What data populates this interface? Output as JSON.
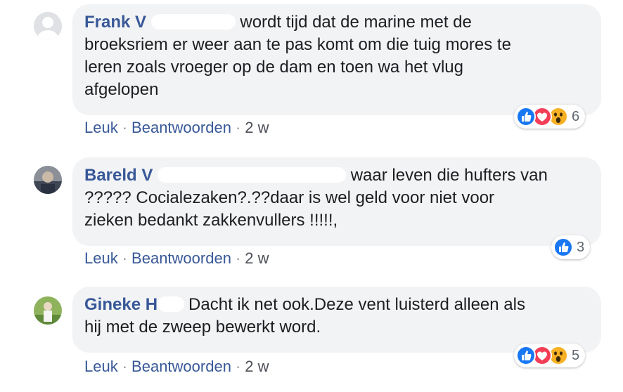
{
  "comments": [
    {
      "name": "Frank V",
      "line1": "wordt tijd dat de marine met de",
      "line2": "broeksriem er weer aan te pas komt om die tuig mores te",
      "line3": "leren zoals vroeger op de dam en toen wa het vlug",
      "line4": "afgelopen",
      "actions": {
        "like": "Leuk",
        "reply": "Beantwoorden",
        "time": "2 w"
      },
      "reactions": {
        "icons": [
          "like-icon",
          "love-icon",
          "wow-icon"
        ],
        "count": "6"
      }
    },
    {
      "name": "Bareld V",
      "line1": "waar leven die hufters van",
      "line2": "????? Cocialezaken?.??daar is wel geld voor niet voor",
      "line3": "zieken bedankt zakkenvullers !!!!!,",
      "actions": {
        "like": "Leuk",
        "reply": "Beantwoorden",
        "time": "2 w"
      },
      "reactions": {
        "icons": [
          "like-icon"
        ],
        "count": "3"
      }
    },
    {
      "name": "Gineke H",
      "line1": "Dacht ik net ook.Deze vent luisterd alleen als",
      "line2": "hij met de zweep bewerkt word.",
      "actions": {
        "like": "Leuk",
        "reply": "Beantwoorden",
        "time": "2 w"
      },
      "reactions": {
        "icons": [
          "like-icon",
          "love-icon",
          "wow-icon"
        ],
        "count": "5"
      }
    }
  ],
  "colors": {
    "name": "#385898",
    "bubble": "#f2f3f5",
    "like": "#1877f2",
    "love": "#f33e58",
    "wow": "#f7b125"
  }
}
